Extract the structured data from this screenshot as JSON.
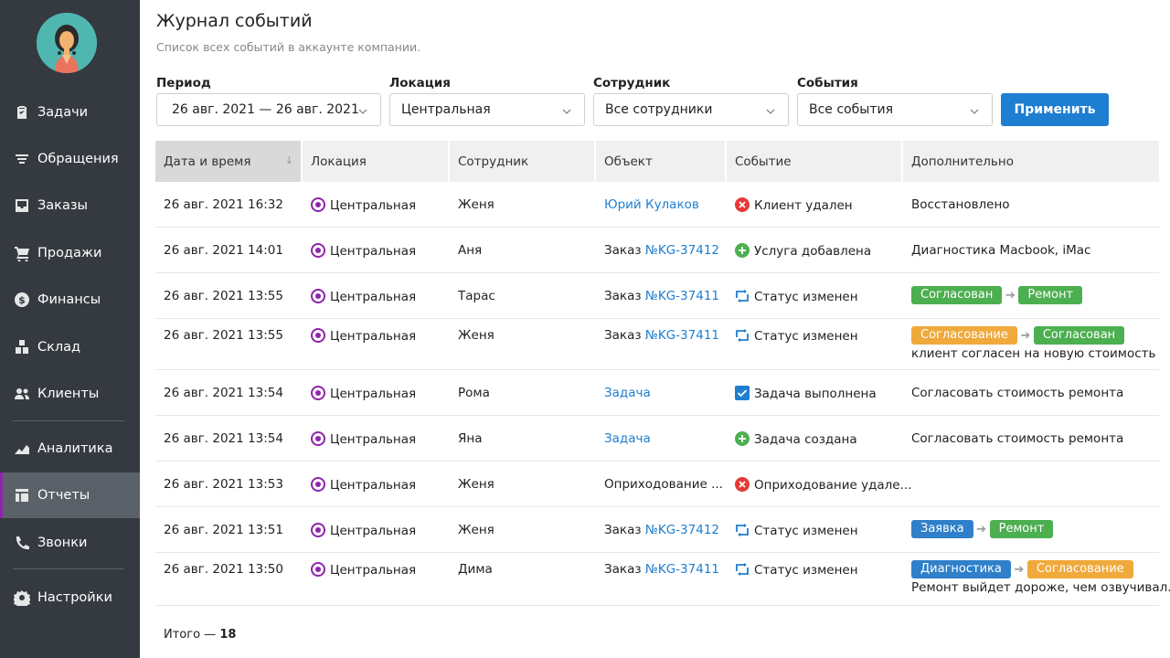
{
  "sidebar": {
    "items": [
      {
        "label": "Задачи",
        "icon": "clipboard-icon"
      },
      {
        "label": "Обращения",
        "icon": "filter-icon"
      },
      {
        "label": "Заказы",
        "icon": "inbox-icon"
      },
      {
        "label": "Продажи",
        "icon": "cart-icon"
      },
      {
        "label": "Финансы",
        "icon": "dollar-icon"
      },
      {
        "label": "Склад",
        "icon": "boxes-icon"
      },
      {
        "label": "Клиенты",
        "icon": "users-icon"
      },
      {
        "label": "Аналитика",
        "icon": "chart-icon"
      },
      {
        "label": "Отчеты",
        "icon": "table-icon",
        "active": true
      },
      {
        "label": "Звонки",
        "icon": "phone-icon"
      },
      {
        "label": "Настройки",
        "icon": "gear-icon"
      }
    ]
  },
  "page": {
    "title": "Журнал событий",
    "subtitle": "Список всех событий в аккаунте компании."
  },
  "filters": {
    "period_label": "Период",
    "period_value": "26 авг. 2021 — 26 авг. 2021",
    "location_label": "Локация",
    "location_value": "Центральная",
    "employee_label": "Сотрудник",
    "employee_value": "Все сотрудники",
    "events_label": "События",
    "events_value": "Все события",
    "apply_label": "Применить"
  },
  "table": {
    "columns": [
      "Дата и время",
      "Локация",
      "Сотрудник",
      "Объект",
      "Событие",
      "Дополнительно"
    ],
    "rows": [
      {
        "date": "26 авг. 2021 16:32",
        "location": "Центральная",
        "employee": "Женя",
        "object_prefix": "",
        "object_link": "Юрий Кулаков",
        "object_text": "",
        "event": "Клиент удален",
        "event_type": "removed",
        "extra": "Восстановлено"
      },
      {
        "date": "26 авг. 2021 14:01",
        "location": "Центральная",
        "employee": "Аня",
        "object_prefix": "Заказ ",
        "object_link": "№KG-37412",
        "object_text": "",
        "event": "Услуга добавлена",
        "event_type": "added",
        "extra": "Диагностика Macbook, iMac"
      },
      {
        "date": "26 авг. 2021 13:55",
        "location": "Центральная",
        "employee": "Тарас",
        "object_prefix": "Заказ ",
        "object_link": "№KG-37411",
        "object_text": "",
        "event": "Статус изменен",
        "event_type": "status",
        "from": "Согласован",
        "to": "Ремонт"
      },
      {
        "date": "26 авг. 2021 13:55",
        "location": "Центральная",
        "employee": "Женя",
        "object_prefix": "Заказ ",
        "object_link": "№KG-37411",
        "object_text": "",
        "event": "Статус изменен",
        "event_type": "status",
        "from": "Согласование",
        "to": "Согласован",
        "note": "клиент согласен на новую стоимость"
      },
      {
        "date": "26 авг. 2021 13:54",
        "location": "Центральная",
        "employee": "Рома",
        "object_prefix": "",
        "object_link": "Задача",
        "object_text": "",
        "event": "Задача выполнена",
        "event_type": "done",
        "extra": "Согласовать стоимость ремонта"
      },
      {
        "date": "26 авг. 2021 13:54",
        "location": "Центральная",
        "employee": "Яна",
        "object_prefix": "",
        "object_link": "Задача",
        "object_text": "",
        "event": "Задача создана",
        "event_type": "added",
        "extra": "Согласовать стоимость ремонта"
      },
      {
        "date": "26 авг. 2021 13:53",
        "location": "Центральная",
        "employee": "Женя",
        "object_prefix": "",
        "object_link": "",
        "object_text": "Оприходование ...",
        "event": "Оприходование удале...",
        "event_type": "removed",
        "extra": ""
      },
      {
        "date": "26 авг. 2021 13:51",
        "location": "Центральная",
        "employee": "Женя",
        "object_prefix": "Заказ ",
        "object_link": "№KG-37412",
        "object_text": "",
        "event": "Статус изменен",
        "event_type": "status",
        "from": "Заявка",
        "to": "Ремонт"
      },
      {
        "date": "26 авг. 2021 13:50",
        "location": "Центральная",
        "employee": "Дима",
        "object_prefix": "Заказ ",
        "object_link": "№KG-37411",
        "object_text": "",
        "event": "Статус изменен",
        "event_type": "status",
        "from": "Диагностика",
        "to": "Согласование",
        "note": "Ремонт выйдет дороже, чем озвучивал..."
      }
    ]
  },
  "status_colors": {
    "Согласован": "#4caf50",
    "Ремонт": "#4caf50",
    "Согласование": "#f0a93b",
    "Заявка": "#2f80c9",
    "Диагностика": "#2f80c9"
  },
  "footer": {
    "total_label": "Итого — ",
    "total_value": "18"
  }
}
